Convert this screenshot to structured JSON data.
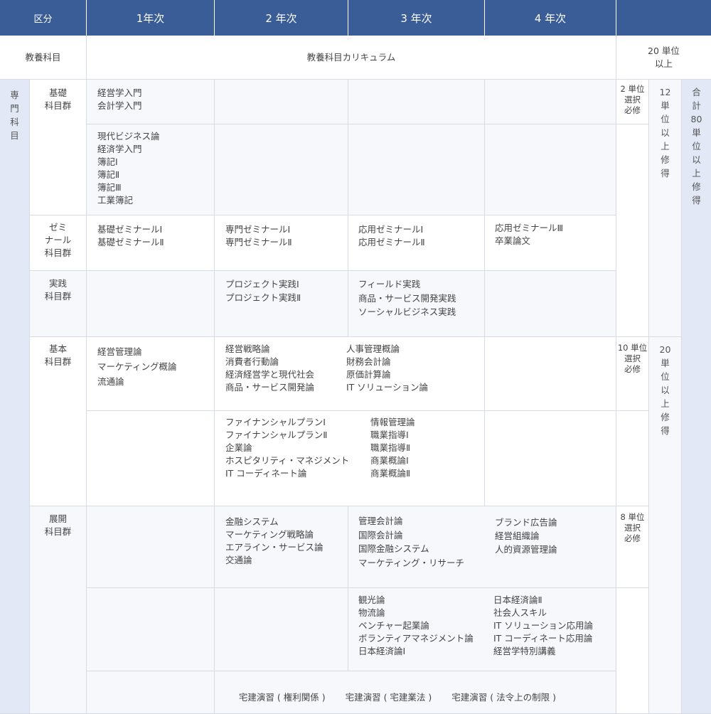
{
  "header": {
    "category": "区分",
    "year1": "1年次",
    "year2": "2 年次",
    "year3": "3 年次",
    "year4": "4 年次"
  },
  "general": {
    "label": "教養科目",
    "curriculum": "教養科目カリキュラム",
    "credits": "20 単位\n以上"
  },
  "specialized": {
    "label": [
      "専",
      "門",
      "科",
      "目"
    ],
    "total_credits": [
      "合",
      "計",
      "80",
      "単",
      "位",
      "以",
      "上",
      "修",
      "得"
    ],
    "groups": {
      "kiso": {
        "label": "基礎\n科目群",
        "row1_y1": "経営学入門\n会計学入門",
        "row2_y1": "現代ビジネス論\n経済学入門\n簿記Ⅰ\n簿記Ⅱ\n簿記Ⅲ\n工業簿記",
        "required": "2 単位\n選択\n必修"
      },
      "seminar": {
        "label": "ゼミ\nナール\n科目群",
        "y1": "基礎ゼミナールⅠ\n基礎ゼミナールⅡ",
        "y2": "専門ゼミナールⅠ\n専門ゼミナールⅡ",
        "y3": "応用ゼミナールⅠ\n応用ゼミナールⅡ",
        "y4": "応用ゼミナールⅢ\n卒業論文"
      },
      "jissen": {
        "label": "実践\n科目群",
        "y2": "プロジェクト実践Ⅰ\nプロジェクト実践Ⅱ",
        "y3": "フィールド実践\n商品・サービス開発実践\nソーシャルビジネス実践"
      },
      "upper_credits": [
        "12",
        "単",
        "位",
        "以",
        "上",
        "修",
        "得"
      ],
      "kihon": {
        "label": "基本\n科目群",
        "row1_y1": "経営管理論\nマーケティング概論\n流通論",
        "row1_y23a": "経営戦略論\n消費者行動論\n経済経営学と現代社会\n商品・サービス開発論",
        "row1_y23b": "人事管理概論\n財務会計論\n原価計算論\nIT ソリューション論",
        "row2_y23a": "ファイナンシャルプランⅠ\nファイナンシャルプランⅡ\n企業論\nホスピタリティ・マネジメント\nIT コーディネート論",
        "row2_y23b": "情報管理論\n職業指導Ⅰ\n職業指導Ⅱ\n商業概論Ⅰ\n商業概論Ⅱ",
        "required": "10 単位\n選択\n必修"
      },
      "lower_credits": [
        "20",
        "単",
        "位",
        "以",
        "上",
        "修",
        "得"
      ],
      "tenkai": {
        "label": "展開\n科目群",
        "row1_y2": "金融システム\nマーケティング戦略論\nエアライン・サービス論\n交通論",
        "row1_y3": "管理会計論\n国際会計論\n国際金融システム\nマーケティング・リサーチ",
        "row1_y4": "ブランド広告論\n経営組織論\n人的資源管理論",
        "row2_y3": "観光論\n物流論\nベンチャー起業論\nボランティアマネジメント論\n日本経済論Ⅰ",
        "row2_y4": "日本経済論Ⅱ\n社会人スキル\nIT ソリューション応用論\nIT コーディネート応用論\n経営学特別講義",
        "row3_items": [
          "宅建演習 ( 権利関係 )",
          "宅建演習 ( 宅建業法 )",
          "宅建演習 ( 法令上の制限 )"
        ],
        "required": "8 単位\n選択\n必修"
      }
    }
  },
  "colors": {
    "header_bg": "#3a5d97",
    "header_text": "#ffffff",
    "border": "#d6dbe6",
    "cell_bg": "#f7f8fb",
    "total_bg": "#e2e8f5"
  }
}
